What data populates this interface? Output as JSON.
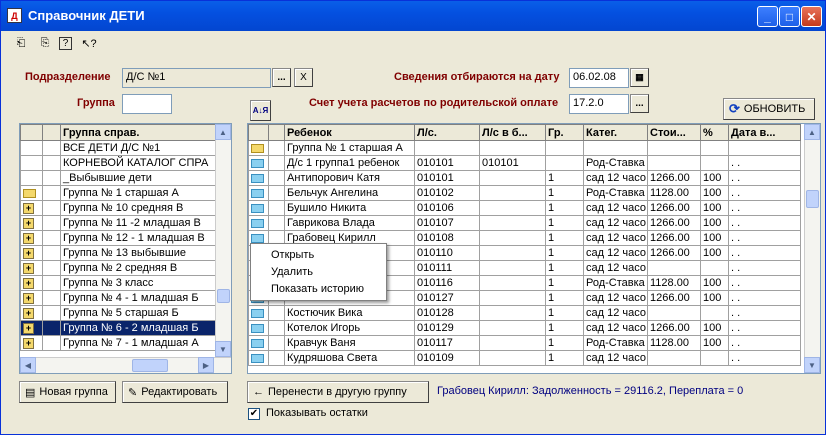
{
  "window": {
    "title": "Справочник ДЕТИ"
  },
  "filters": {
    "subdivision_label": "Подразделение",
    "subdivision_value": "Д/С №1",
    "group_label": "Группа",
    "group_value": "",
    "date_label": "Сведения отбираются на дату",
    "date_value": "06.02.08",
    "account_label": "Счет учета расчетов по родительской оплате",
    "account_value": "17.2.0",
    "browse": "...",
    "clear": "X",
    "sort": "A↓Я",
    "refresh_label": "ОБНОВИТЬ"
  },
  "left_grid": {
    "header": "Группа справ.",
    "rows": [
      {
        "icon": "",
        "label": "ВСЕ ДЕТИ Д/С №1"
      },
      {
        "icon": "",
        "label": "КОРНЕВОЙ КАТАЛОГ СПРА"
      },
      {
        "icon": "",
        "label": "_Выбывшие дети"
      },
      {
        "icon": "plus",
        "label": "Группа № 1 старшая А"
      },
      {
        "icon": "plus",
        "label": "Группа № 10 средняя В"
      },
      {
        "icon": "plus",
        "label": "Группа № 11 -2 младшая В"
      },
      {
        "icon": "plus",
        "label": "Группа № 12 - 1 младшая В"
      },
      {
        "icon": "plus",
        "label": "Группа № 13 выбывшие"
      },
      {
        "icon": "plus",
        "label": "Группа № 2  средняя В"
      },
      {
        "icon": "plus",
        "label": "Группа № 3  класс"
      },
      {
        "icon": "plus",
        "label": "Группа № 4 - 1 младшая Б"
      },
      {
        "icon": "plus",
        "label": "Группа № 5  старшая Б"
      },
      {
        "icon": "plus",
        "label": "Группа № 6 - 2 младшая Б"
      },
      {
        "icon": "plus",
        "label": "Группа № 7 - 1 младшая А"
      }
    ]
  },
  "right_grid": {
    "headers": [
      "Ребенок",
      "Л/с.",
      "Л/с в б...",
      "Гр.",
      "Катег.",
      "Стои...",
      "%",
      "Дата в..."
    ],
    "rows": [
      [
        "Группа № 1 старшая А",
        "",
        "",
        "",
        "",
        "",
        "",
        ""
      ],
      [
        "Д/с 1 группа1 ребенок",
        "010101",
        "010101",
        "",
        "Род-Ставка",
        "",
        "",
        ". ."
      ],
      [
        "Антипорович Катя",
        "010101",
        "",
        "1",
        "сад 12 часо",
        "1266.00",
        "100",
        ". ."
      ],
      [
        "Бельчук Ангелина",
        "010102",
        "",
        "1",
        "Род-Ставка",
        "1128.00",
        "100",
        ". ."
      ],
      [
        "Бушило Никита",
        "010106",
        "",
        "1",
        "сад 12 часо",
        "1266.00",
        "100",
        ". ."
      ],
      [
        "Гаврикова Влада",
        "010107",
        "",
        "1",
        "сад 12 часо",
        "1266.00",
        "100",
        ". ."
      ],
      [
        "Грабовец Кирилл",
        "010108",
        "",
        "1",
        "сад 12 часо",
        "1266.00",
        "100",
        ". ."
      ],
      [
        "",
        "010110",
        "",
        "1",
        "сад 12 часо",
        "1266.00",
        "100",
        ". ."
      ],
      [
        "",
        "010111",
        "",
        "1",
        "сад 12 часо",
        "",
        "",
        ". ."
      ],
      [
        "",
        "010116",
        "",
        "1",
        "Род-Ставка",
        "1128.00",
        "100",
        ". ."
      ],
      [
        "",
        "010127",
        "",
        "1",
        "сад 12 часо",
        "1266.00",
        "100",
        ". ."
      ],
      [
        "Костючик Вика",
        "010128",
        "",
        "1",
        "сад 12 часо",
        "",
        "",
        ". ."
      ],
      [
        "Котелок Игорь",
        "010129",
        "",
        "1",
        "сад 12 часо",
        "1266.00",
        "100",
        ". ."
      ],
      [
        "Кравчук Ваня",
        "010117",
        "",
        "1",
        "Род-Ставка",
        "1128.00",
        "100",
        ". ."
      ],
      [
        "Кудряшова Света",
        "010109",
        "",
        "1",
        "сад 12 часо",
        "",
        "",
        ". ."
      ]
    ]
  },
  "context_menu": [
    "Открыть",
    "Удалить",
    "Показать историю"
  ],
  "bottom": {
    "new_group": "Новая группа",
    "edit": "Редактировать",
    "move": "Перенести  в другую группу",
    "status": "Грабовец Кирилл: Задолженность = 29116.2, Переплата = 0",
    "show_balances": "Показывать остатки"
  }
}
